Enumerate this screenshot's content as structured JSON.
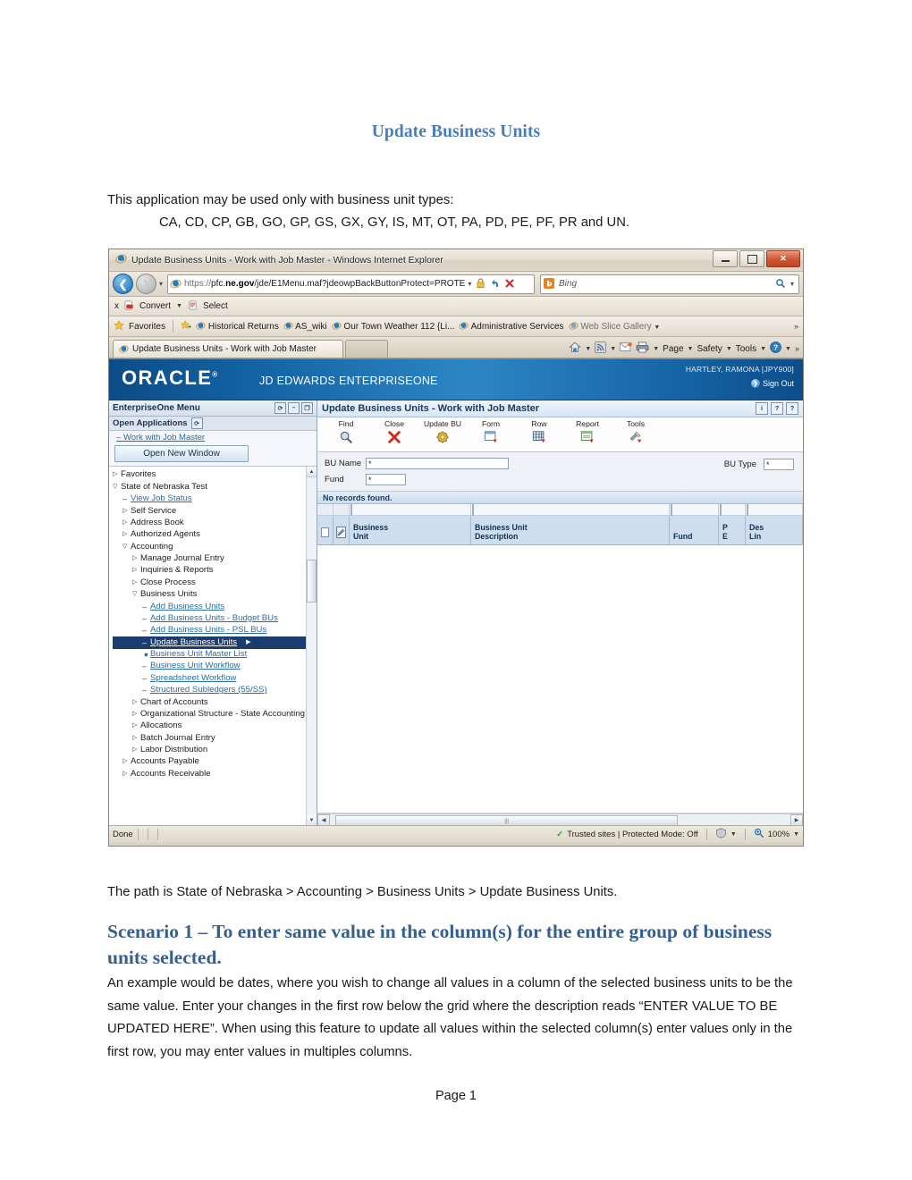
{
  "document": {
    "title": "Update Business Units",
    "intro_line1": "This application may be used only with business unit types:",
    "intro_line2": "CA, CD, CP, GB, GO, GP, GS, GX, GY, IS, MT, OT, PA, PD, PE, PF, PR and UN.",
    "path_line": "The path is State of Nebraska > Accounting > Business Units > Update Business Units.",
    "scenario_heading": "Scenario 1 – To enter same value in the column(s) for the entire group of business units selected.",
    "body_paragraph": "An example would be dates, where you wish to change all values in a column of the selected business units to be the same value.  Enter your changes in the first row below the grid where the description reads “ENTER VALUE TO BE UPDATED HERE”.  When using this feature to update all values within the selected column(s) enter values only in the first row, you may enter values in multiples columns.",
    "page_number": "Page  1",
    "heading_color": "#4a7ebb",
    "scenario_color": "#365f91"
  },
  "browser": {
    "window_title": "Update Business Units - Work with Job Master - Windows Internet Explorer",
    "address": {
      "protocol": "https://",
      "host_pre": "pfc.",
      "host_bold": "ne.gov",
      "path": "/jde/E1Menu.maf?jdeowpBackButtonProtect=PROTE"
    },
    "search_placeholder": "Bing",
    "command_bar": {
      "close_label": "x",
      "convert_label": "Convert",
      "select_label": "Select"
    },
    "favorites_bar": {
      "favorites_label": "Favorites",
      "items": [
        "Historical Returns",
        "AS_wiki",
        "Our Town Weather 112 {Li...",
        "Administrative Services",
        "Web Slice Gallery"
      ]
    },
    "tab_label": "Update Business Units - Work with Job Master",
    "tools_menu": [
      "Page",
      "Safety",
      "Tools"
    ],
    "status": {
      "left": "Done",
      "zone": "Trusted sites | Protected Mode: Off",
      "zoom": "100%"
    }
  },
  "oracle": {
    "logo": "ORACLE",
    "product": "JD EDWARDS ENTERPRISEONE",
    "user": "HARTLEY, RAMONA  [JPY900]",
    "sign_out": "Sign Out"
  },
  "menu": {
    "header": "EnterpriseOne Menu",
    "open_applications_label": "Open Applications",
    "open_application": "Work with Job Master",
    "open_new_window": "Open New Window",
    "tree": [
      {
        "label": "Favorites",
        "marker": "collapsed",
        "indent": 0,
        "link": false
      },
      {
        "label": "State of Nebraska Test",
        "marker": "expanded",
        "indent": 0,
        "link": false
      },
      {
        "label": "View Job Status",
        "marker": "dash",
        "indent": 1,
        "link": true
      },
      {
        "label": "Self Service",
        "marker": "collapsed",
        "indent": 1,
        "link": false
      },
      {
        "label": "Address Book",
        "marker": "collapsed",
        "indent": 1,
        "link": false
      },
      {
        "label": "Authorized Agents",
        "marker": "collapsed",
        "indent": 1,
        "link": false
      },
      {
        "label": "Accounting",
        "marker": "expanded",
        "indent": 1,
        "link": false
      },
      {
        "label": "Manage Journal Entry",
        "marker": "collapsed",
        "indent": 2,
        "link": false
      },
      {
        "label": "Inquiries & Reports",
        "marker": "collapsed",
        "indent": 2,
        "link": false
      },
      {
        "label": "Close Process",
        "marker": "collapsed",
        "indent": 2,
        "link": false
      },
      {
        "label": "Business Units",
        "marker": "expanded",
        "indent": 2,
        "link": false
      },
      {
        "label": "Add Business Units",
        "marker": "dash",
        "indent": 3,
        "link": true
      },
      {
        "label": "Add Business Units - Budget BUs",
        "marker": "dash",
        "indent": 3,
        "link": true
      },
      {
        "label": "Add Business Units - PSL BUs",
        "marker": "dash",
        "indent": 3,
        "link": true
      },
      {
        "label": "Update Business Units",
        "marker": "dash",
        "indent": 3,
        "link": true,
        "selected": true
      },
      {
        "label": "Business Unit Master List",
        "marker": "bullet",
        "indent": 3,
        "link": true
      },
      {
        "label": "Business Unit Workflow",
        "marker": "dash",
        "indent": 3,
        "link": true
      },
      {
        "label": "Spreadsheet Workflow",
        "marker": "dash",
        "indent": 3,
        "link": true
      },
      {
        "label": "Structured Subledgers (55/SS)",
        "marker": "dash",
        "indent": 3,
        "link": true
      },
      {
        "label": "Chart of Accounts",
        "marker": "collapsed",
        "indent": 2,
        "link": false
      },
      {
        "label": "Organizational Structure - State Accounting",
        "marker": "collapsed",
        "indent": 2,
        "link": false
      },
      {
        "label": "Allocations",
        "marker": "collapsed",
        "indent": 2,
        "link": false
      },
      {
        "label": "Batch Journal Entry",
        "marker": "collapsed",
        "indent": 2,
        "link": false
      },
      {
        "label": "Labor Distribution",
        "marker": "collapsed",
        "indent": 2,
        "link": false
      },
      {
        "label": "Accounts Payable",
        "marker": "collapsed",
        "indent": 1,
        "link": false
      },
      {
        "label": "Accounts Receivable",
        "marker": "collapsed",
        "indent": 1,
        "link": false
      }
    ]
  },
  "form": {
    "title": "Update Business Units - Work with Job Master",
    "toolbar": [
      {
        "label": "Find",
        "icon": "magnifier-icon"
      },
      {
        "label": "Close",
        "icon": "red-x-icon"
      },
      {
        "label": "Update BU",
        "icon": "gear-icon"
      },
      {
        "label": "Form",
        "icon": "form-window-icon"
      },
      {
        "label": "Row",
        "icon": "grid-icon"
      },
      {
        "label": "Report",
        "icon": "report-icon"
      },
      {
        "label": "Tools",
        "icon": "tools-icon"
      }
    ],
    "fields": {
      "bu_name_label": "BU Name",
      "bu_name_value": "*",
      "fund_label": "Fund",
      "fund_value": "*",
      "bu_type_label": "BU Type",
      "bu_type_value": "*"
    },
    "grid": {
      "status": "No records found.",
      "columns": [
        {
          "line1": "Business",
          "line2": "Unit"
        },
        {
          "line1": "Business Unit",
          "line2": "Description"
        },
        {
          "line1": "",
          "line2": "Fund"
        },
        {
          "line1": "P",
          "line2": "E"
        },
        {
          "line1": "Des",
          "line2": "Lin"
        }
      ]
    }
  }
}
